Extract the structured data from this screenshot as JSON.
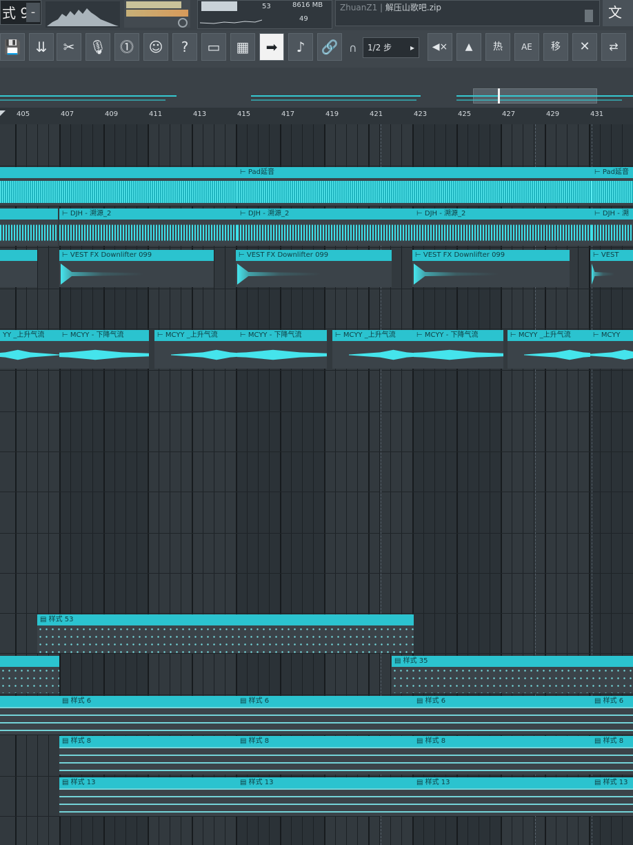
{
  "topbar": {
    "pattern_selector": "式 9",
    "pattern_arrow": "-",
    "cpu_top": "53",
    "mem_value": "8616 MB",
    "polyphony": "49",
    "hint_prefix": "ZhuanZ1 | ",
    "hint_text": "解压山歌吧.zip",
    "menu_file": "文件"
  },
  "toolbar": {
    "buttons": [
      "💾",
      "⇊",
      "✂",
      "🎙",
      "⓵",
      "☺",
      "?",
      "▭",
      "▦",
      "➡",
      "♪",
      "🔗"
    ],
    "snap_value": "1/2 步",
    "snap_arrow": "▸",
    "right_buttons": [
      "◀×",
      "▲",
      "热",
      "AE",
      "移",
      "✕",
      "⇄"
    ]
  },
  "ruler": {
    "ticks": [
      "405",
      "407",
      "409",
      "411",
      "413",
      "415",
      "417",
      "419",
      "421",
      "423",
      "425",
      "427",
      "429",
      "431"
    ]
  },
  "clips": {
    "pad": "⊢ Pad延音",
    "pad2": "⊢ Pad延音",
    "djh": "⊢ DJH - 溯源_2",
    "djh2": "⊢ DJH - 溯源_2",
    "djh3": "⊢ DJH - 溯源_2",
    "djh4": "⊢ DJH - 溯",
    "vest": "⊢ VEST FX Downlifter 099",
    "vest2": "⊢ VEST FX Downlifter 099",
    "vest3": "⊢ VEST FX Downlifter 099",
    "vest4": "⊢ VEST",
    "mcyy_up_partial": "YY _上升气流",
    "mcyy_down": "⊢ MCYY - 下降气流",
    "mcyy_up": "⊢ MCYY _上升气流",
    "mcyy_down2": "⊢ MCYY - 下降气流",
    "mcyy_up2": "⊢ MCYY _上升气流",
    "mcyy_down3": "⊢ MCYY - 下降气流",
    "mcyy_up3": "⊢ MCYY _上升气流",
    "mcyy_down4": "⊢ MCYY",
    "pattern53": "▤ 样式 53",
    "pattern35": "▤ 样式 35",
    "pattern6": "▤ 样式 6",
    "pattern8": "▤ 样式 8",
    "pattern13": "▤ 样式 13"
  },
  "colors": {
    "clip_head": "#2bc3cf",
    "waveform": "#3ee0ea",
    "background": "#2b3237"
  }
}
